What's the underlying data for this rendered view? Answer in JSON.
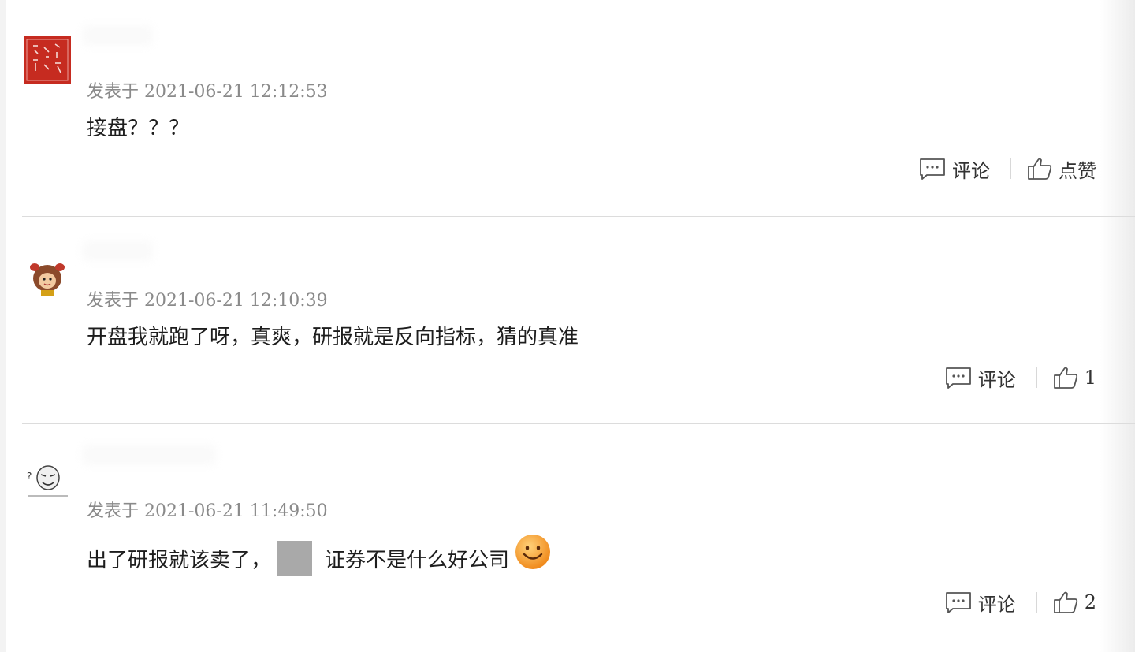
{
  "comments": [
    {
      "avatar": "red-seal-avatar",
      "meta": "发表于 2021-06-21 12:12:53",
      "content": "接盘？？？",
      "comment_label": "评论",
      "like_label": "点赞"
    },
    {
      "avatar": "cartoon-avatar",
      "meta": "发表于 2021-06-21 12:10:39",
      "content": "开盘我就跑了呀，真爽，研报就是反向指标，猜的真准",
      "comment_label": "评论",
      "like_label": "1"
    },
    {
      "avatar": "meme-avatar",
      "meta": "发表于 2021-06-21 11:49:50",
      "content_a": "出了研报就该卖了，",
      "content_b": "证券不是什么好公司",
      "comment_label": "评论",
      "like_label": "2"
    }
  ],
  "icons": {
    "comment": "comment-bubble-icon",
    "like": "thumbs-up-icon",
    "emoji": "smile-emoji-icon"
  },
  "colors": {
    "meta_text": "#8a8a8a",
    "divider": "#dcdcdc",
    "redacted_block": "#a9a9a9",
    "emoji_face": "#f5a623"
  }
}
